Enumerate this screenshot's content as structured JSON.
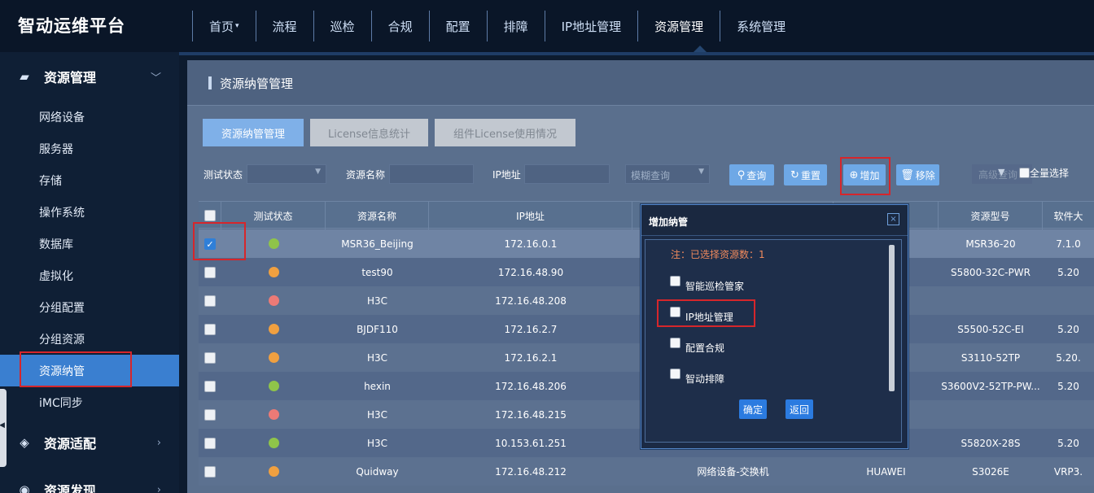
{
  "app": {
    "title": "智动运维平台"
  },
  "nav": {
    "items": [
      {
        "label": "首页",
        "caret": "▾"
      },
      {
        "label": "流程"
      },
      {
        "label": "巡检"
      },
      {
        "label": "合规"
      },
      {
        "label": "配置"
      },
      {
        "label": "排障"
      },
      {
        "label": "IP地址管理"
      },
      {
        "label": "资源管理"
      },
      {
        "label": "系统管理"
      }
    ],
    "active": "资源管理"
  },
  "sidebar": {
    "group_resource": {
      "label": "资源管理",
      "icon": "folder-icon",
      "chevron": "﹀"
    },
    "items": [
      {
        "label": "网络设备"
      },
      {
        "label": "服务器"
      },
      {
        "label": "存储"
      },
      {
        "label": "操作系统"
      },
      {
        "label": "数据库"
      },
      {
        "label": "虚拟化"
      },
      {
        "label": "分组配置"
      },
      {
        "label": "分组资源"
      },
      {
        "label": "资源纳管"
      },
      {
        "label": "iMC同步"
      }
    ],
    "active_item": "资源纳管",
    "group_adapt": {
      "label": "资源适配",
      "icon": "puzzle-icon",
      "chevron": "›"
    },
    "group_discover": {
      "label": "资源发现",
      "icon": "compass-icon",
      "chevron": "›"
    }
  },
  "main": {
    "title": "资源纳管管理",
    "tabs": [
      {
        "label": "资源纳管管理",
        "active": true
      },
      {
        "label": "License信息统计",
        "active": false
      },
      {
        "label": "组件License使用情况",
        "active": false
      }
    ],
    "filters": {
      "test_status_label": "测试状态",
      "resource_name_label": "资源名称",
      "ip_label": "IP地址",
      "fuzzy_query": "模糊查询",
      "dropdown_caret": "▼"
    },
    "buttons": {
      "query": "查询",
      "reset": "重置",
      "add": "增加",
      "remove": "移除",
      "advanced": "高级查询",
      "select_all": "全量选择"
    },
    "table": {
      "columns": [
        "测试状态",
        "资源名称",
        "IP地址",
        "",
        "",
        "资源型号",
        "软件大"
      ],
      "rows": [
        {
          "checked": true,
          "status": "green",
          "name": "MSR36_Beijing",
          "ip": "172.16.0.1",
          "type": "",
          "vendor": "",
          "model": "MSR36-20",
          "sw": "7.1.0"
        },
        {
          "checked": false,
          "status": "orange",
          "name": "test90",
          "ip": "172.16.48.90",
          "type": "",
          "vendor": "",
          "model": "S5800-32C-PWR",
          "sw": "5.20"
        },
        {
          "checked": false,
          "status": "red",
          "name": "H3C",
          "ip": "172.16.48.208",
          "type": "",
          "vendor": "",
          "model": "",
          "sw": ""
        },
        {
          "checked": false,
          "status": "orange",
          "name": "BJDF110",
          "ip": "172.16.2.7",
          "type": "",
          "vendor": "",
          "model": "S5500-52C-EI",
          "sw": "5.20"
        },
        {
          "checked": false,
          "status": "orange",
          "name": "H3C",
          "ip": "172.16.2.1",
          "type": "",
          "vendor": "",
          "model": "S3110-52TP",
          "sw": "5.20."
        },
        {
          "checked": false,
          "status": "green",
          "name": "hexin",
          "ip": "172.16.48.206",
          "type": "",
          "vendor": "",
          "model": "S3600V2-52TP-PW...",
          "sw": "5.20"
        },
        {
          "checked": false,
          "status": "red",
          "name": "H3C",
          "ip": "172.16.48.215",
          "type": "",
          "vendor": "",
          "model": "",
          "sw": ""
        },
        {
          "checked": false,
          "status": "green",
          "name": "H3C",
          "ip": "10.153.61.251",
          "type": "",
          "vendor": "",
          "model": "S5820X-28S",
          "sw": "5.20"
        },
        {
          "checked": false,
          "status": "orange",
          "name": "Quidway",
          "ip": "172.16.48.212",
          "type": "网络设备-交换机",
          "vendor": "HUAWEI",
          "model": "S3026E",
          "sw": "VRP3."
        }
      ]
    }
  },
  "modal": {
    "title": "增加纳管",
    "close": "×",
    "note": "注：已选择资源数：1",
    "options": [
      {
        "label": "智能巡检管家"
      },
      {
        "label": "IP地址管理"
      },
      {
        "label": "配置合规"
      },
      {
        "label": "智动排障"
      }
    ],
    "ok": "确定",
    "back": "返回"
  },
  "colors": {
    "green": "#8fc44a",
    "orange": "#f0a040",
    "red": "#ec7a76",
    "accent": "#3a7fd0",
    "highlight": "#d6262b"
  }
}
